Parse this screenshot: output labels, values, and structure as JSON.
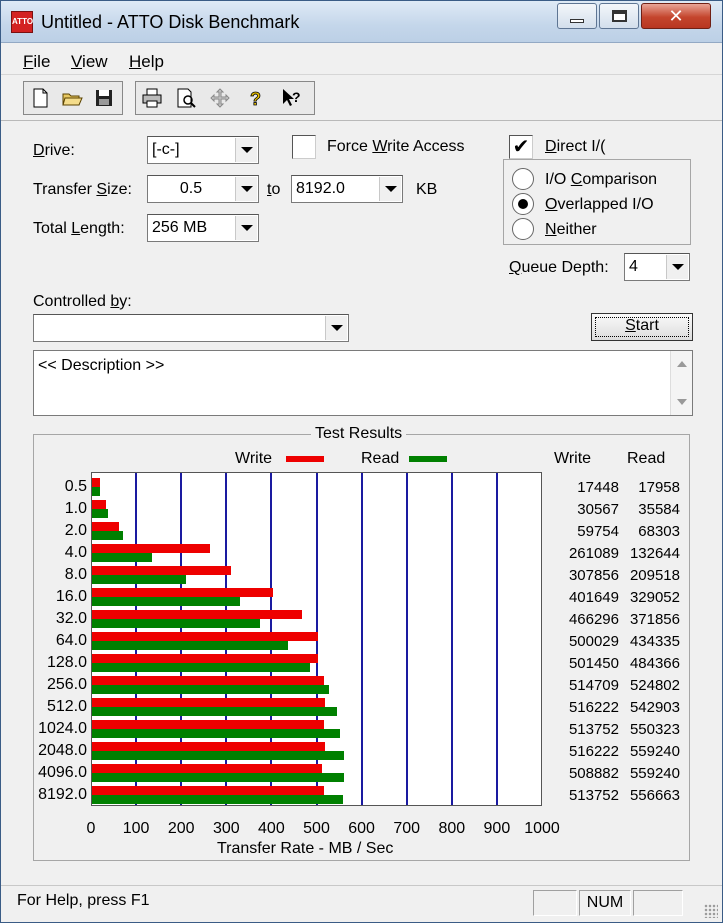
{
  "window": {
    "title": "Untitled - ATTO Disk Benchmark",
    "icon": "atto-app-icon",
    "icon_text": "ATTO",
    "close_glyph": "✕"
  },
  "menu": [
    {
      "label": "File"
    },
    {
      "label": "View"
    },
    {
      "label": "Help"
    }
  ],
  "toolbar": {
    "icons": [
      "new-file-icon",
      "open-folder-icon",
      "save-disk-icon",
      "print-icon",
      "print-preview-icon",
      "move-cross-icon",
      "help-question-icon",
      "context-help-icon"
    ]
  },
  "form": {
    "drive_label": "Drive:",
    "drive_value": "[-c-]",
    "force_write_label": "Force Write Access",
    "force_write_checked": false,
    "direct_io_label": "Direct I/(",
    "direct_io_checked": true,
    "check_glyph": "✔",
    "transfer_size_label": "Transfer Size:",
    "transfer_from": "0.5",
    "to_label": "to",
    "transfer_to": "8192.0",
    "kb_label": "KB",
    "total_length_label": "Total Length:",
    "total_length_value": "256 MB",
    "io_options": [
      {
        "label": "I/O Comparison",
        "selected": false
      },
      {
        "label": "Overlapped I/O",
        "selected": true
      },
      {
        "label": "Neither",
        "selected": false
      }
    ],
    "queue_depth_label": "Queue Depth:",
    "queue_depth_value": "4",
    "controlled_by_label": "Controlled by:",
    "controlled_by_value": "",
    "start_button": "Start",
    "description": "<< Description >>"
  },
  "results": {
    "title": "Test Results",
    "legend_write": "Write",
    "legend_read": "Read",
    "col_write": "Write",
    "col_read": "Read",
    "colors": {
      "write": "#ee0000",
      "read": "#008000",
      "grid": "#1a1aa0"
    }
  },
  "chart_data": {
    "type": "bar",
    "orientation": "horizontal",
    "title": "Test Results",
    "xlabel": "Transfer Rate - MB / Sec",
    "ylabel": "",
    "xlim": [
      0,
      1000
    ],
    "x_ticks": [
      0,
      100,
      200,
      300,
      400,
      500,
      600,
      700,
      800,
      900,
      1000
    ],
    "grid": true,
    "legend_placement": "top",
    "categories": [
      "0.5",
      "1.0",
      "2.0",
      "4.0",
      "8.0",
      "16.0",
      "32.0",
      "64.0",
      "128.0",
      "256.0",
      "512.0",
      "1024.0",
      "2048.0",
      "4096.0",
      "8192.0"
    ],
    "series": [
      {
        "name": "Write",
        "color": "#ee0000",
        "values": [
          17.4,
          30.6,
          59.8,
          261.1,
          307.9,
          401.6,
          466.3,
          500.0,
          501.5,
          514.7,
          516.2,
          513.8,
          516.2,
          508.9,
          513.8
        ]
      },
      {
        "name": "Read",
        "color": "#008000",
        "values": [
          18.0,
          35.6,
          68.3,
          132.6,
          209.5,
          329.1,
          371.9,
          434.3,
          484.4,
          524.8,
          542.9,
          550.3,
          559.2,
          559.2,
          556.7
        ]
      }
    ],
    "table": {
      "write": [
        "17448",
        "30567",
        "59754",
        "261089",
        "307856",
        "401649",
        "466296",
        "500029",
        "501450",
        "514709",
        "516222",
        "513752",
        "516222",
        "508882",
        "513752"
      ],
      "read": [
        "17958",
        "35584",
        "68303",
        "132644",
        "209518",
        "329052",
        "371856",
        "434335",
        "484366",
        "524802",
        "542903",
        "550323",
        "559240",
        "559240",
        "556663"
      ]
    }
  },
  "status": {
    "help_text": "For Help, press F1",
    "num": "NUM"
  }
}
